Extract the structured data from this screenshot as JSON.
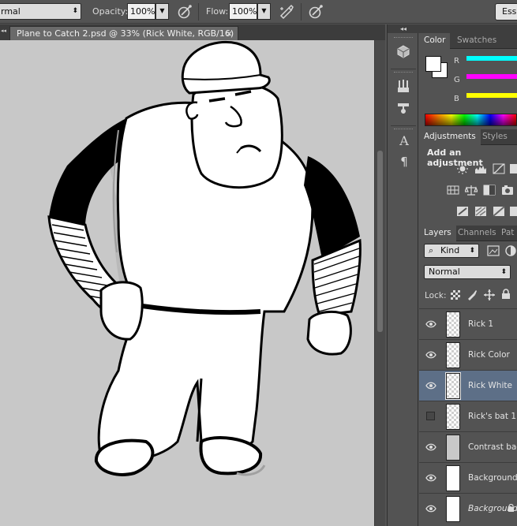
{
  "options_bar": {
    "mode_value": "rmal",
    "opacity_label": "Opacity:",
    "opacity_value": "100%",
    "flow_label": "Flow:",
    "flow_value": "100%",
    "workspace_button": "Esse"
  },
  "document": {
    "tab_title": "Plane to Catch 2.psd @ 33% (Rick White, RGB/16)",
    "tab_close": "×",
    "canvas_background": "#c8c8c8"
  },
  "icon_dock": {
    "collapse_glyph": "◂◂",
    "icons": [
      "3d-cube-icon",
      "brush-presets-icon",
      "clone-source-icon",
      "character-icon",
      "paragraph-icon"
    ],
    "character_glyph": "A",
    "paragraph_glyph": "¶"
  },
  "color_panel": {
    "tabs": [
      "Color",
      "Swatches"
    ],
    "active_tab": "Color",
    "fg_color": "#ffffff",
    "bg_color": "#ffffff",
    "channels": [
      {
        "label": "R",
        "color": "#00ffff"
      },
      {
        "label": "G",
        "color": "#ff00ff"
      },
      {
        "label": "B",
        "color": "#ffff00"
      }
    ]
  },
  "adjustments_panel": {
    "tabs": [
      "Adjustments",
      "Styles"
    ],
    "active_tab": "Adjustments",
    "heading": "Add an adjustment"
  },
  "layers_panel": {
    "tabs": [
      "Layers",
      "Channels",
      "Pat"
    ],
    "active_tab": "Layers",
    "kind_label": "Kind",
    "blend_mode": "Normal",
    "lock_label": "Lock:",
    "selected_color": "#5d6f87",
    "layers": [
      {
        "name": "Rick 1",
        "visible": true,
        "selected": false,
        "thumb": "transparent"
      },
      {
        "name": "Rick Color",
        "visible": true,
        "selected": false,
        "thumb": "transparent"
      },
      {
        "name": "Rick White",
        "visible": true,
        "selected": true,
        "thumb": "transparent"
      },
      {
        "name": "Rick's bat 1",
        "visible": false,
        "selected": false,
        "thumb": "transparent"
      },
      {
        "name": "Contrast back",
        "visible": true,
        "selected": false,
        "thumb": "gray"
      },
      {
        "name": "Background c",
        "visible": true,
        "selected": false,
        "thumb": "white"
      },
      {
        "name": "Background",
        "visible": true,
        "selected": false,
        "thumb": "white",
        "italic": true,
        "locked": true
      }
    ]
  }
}
